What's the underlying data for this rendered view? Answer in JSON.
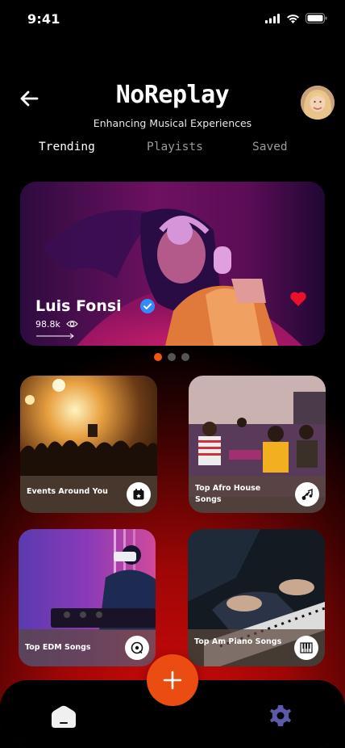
{
  "status_bar": {
    "time": "9:41"
  },
  "header": {
    "title": "NoReplay",
    "subtitle": "Enhancing Musical Experiences"
  },
  "tabs": [
    {
      "label": "Trending",
      "active": true
    },
    {
      "label": "Playists",
      "active": false
    },
    {
      "label": "Saved",
      "active": false
    }
  ],
  "featured": {
    "artist": "Luis Fonsi",
    "verified": true,
    "views": "98.8k",
    "liked": true
  },
  "carousel": {
    "count": 3,
    "active_index": 0
  },
  "cards": [
    {
      "label": "Events Around You",
      "icon": "calendar-icon"
    },
    {
      "label": "Top Afro House Songs",
      "icon": "music-notes-icon"
    },
    {
      "label": "Top EDM Songs",
      "icon": "vinyl-icon"
    },
    {
      "label": "Top Am Piano Songs",
      "icon": "piano-icon"
    }
  ],
  "colors": {
    "accent": "#EA4C12",
    "background_glow": "#D40A0A",
    "heart": "#E8102A",
    "verified": "#2F8CFF",
    "nav_gear": "#5C5AA8"
  }
}
